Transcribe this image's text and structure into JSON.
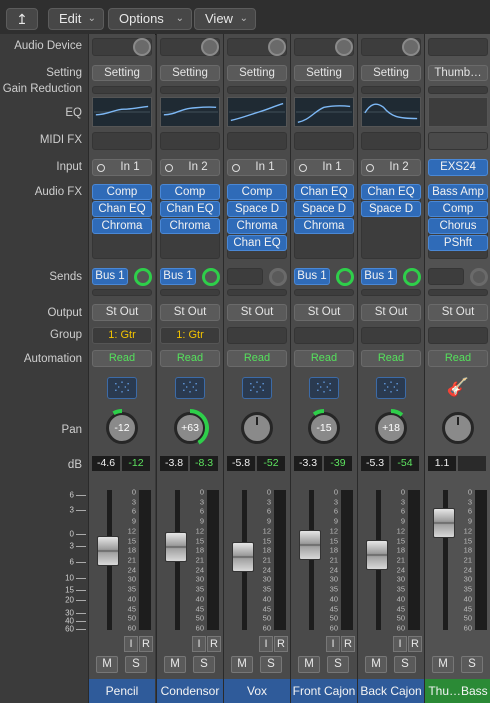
{
  "toolbar": {
    "back_icon": "up-arrow-icon",
    "edit_label": "Edit",
    "options_label": "Options",
    "view_label": "View"
  },
  "row_labels": {
    "audio_device": "Audio Device",
    "setting": "Setting",
    "gain_reduction": "Gain Reduction",
    "eq": "EQ",
    "midi_fx": "MIDI FX",
    "input": "Input",
    "audio_fx": "Audio FX",
    "sends": "Sends",
    "output": "Output",
    "group": "Group",
    "automation": "Automation",
    "pan": "Pan",
    "db": "dB"
  },
  "fader_scale": [
    "6",
    "3",
    "0",
    "3",
    "6",
    "10",
    "15",
    "20",
    "30",
    "40",
    "60"
  ],
  "meter_scale": [
    "0",
    "3",
    "6",
    "9",
    "12",
    "15",
    "18",
    "21",
    "24",
    "30",
    "35",
    "40",
    "45",
    "50",
    "60"
  ],
  "channels": [
    {
      "name": "Pencil",
      "setting": "Setting",
      "input": "In 1",
      "audio_fx": [
        "Comp",
        "Chan EQ",
        "Chroma"
      ],
      "send": "Bus 1",
      "output": "St Out",
      "group": "1: Gtr",
      "automation": "Read",
      "pan": "-12",
      "volume_db": "-4.6",
      "peak_db": "-12",
      "name_color": "#2f5b9a"
    },
    {
      "name": "Condensor",
      "setting": "Setting",
      "input": "In 2",
      "audio_fx": [
        "Comp",
        "Chan EQ",
        "Chroma"
      ],
      "send": "Bus 1",
      "output": "St Out",
      "group": "1: Gtr",
      "automation": "Read",
      "pan": "+63",
      "volume_db": "-3.8",
      "peak_db": "-8.3",
      "name_color": "#2f5b9a"
    },
    {
      "name": "Vox",
      "setting": "Setting",
      "input": "In 1",
      "audio_fx": [
        "Comp",
        "Space D",
        "Chroma",
        "Chan EQ"
      ],
      "send": "",
      "output": "St Out",
      "group": "",
      "automation": "Read",
      "pan": "",
      "volume_db": "-5.8",
      "peak_db": "-52",
      "name_color": "#2f5b9a"
    },
    {
      "name": "Front Cajon",
      "setting": "Setting",
      "input": "In 1",
      "audio_fx": [
        "Chan EQ",
        "Space D",
        "Chroma"
      ],
      "send": "Bus 1",
      "output": "St Out",
      "group": "",
      "automation": "Read",
      "pan": "-15",
      "volume_db": "-3.3",
      "peak_db": "-39",
      "name_color": "#2f5b9a"
    },
    {
      "name": "Back Cajon",
      "setting": "Setting",
      "input": "In 2",
      "audio_fx": [
        "Chan EQ",
        "Space D"
      ],
      "send": "Bus 1",
      "output": "St Out",
      "group": "",
      "automation": "Read",
      "pan": "+18",
      "volume_db": "-5.3",
      "peak_db": "-54",
      "name_color": "#2f5b9a"
    },
    {
      "name": "Thu…Bass",
      "setting": "Thumb…",
      "input": "EXS24",
      "audio_fx": [
        "Bass Amp",
        "Comp",
        "Chorus",
        "PShft"
      ],
      "send": "",
      "output": "St Out",
      "group": "",
      "automation": "Read",
      "pan": "",
      "volume_db": "1.1",
      "peak_db": "",
      "name_color": "#2b8a36"
    }
  ],
  "buttons": {
    "i": "I",
    "r": "R",
    "m": "M",
    "s": "S"
  }
}
